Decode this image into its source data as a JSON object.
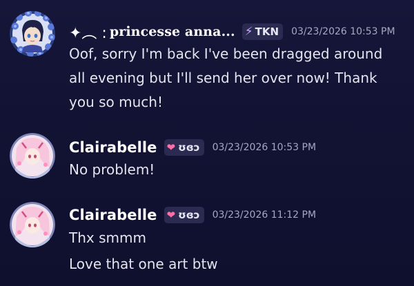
{
  "messages": [
    {
      "author": "princesse anna...",
      "author_prefix": "✦︵ :",
      "tag": {
        "icon": "lightning-icon",
        "text": "TKN"
      },
      "timestamp": "03/23/2026 10:53 PM",
      "lines": [
        "Oof, sorry I'm back I've been dragged around",
        "all evening but I'll send her over now! Thank",
        "you so much!"
      ]
    },
    {
      "author": "Clairabelle",
      "tag": {
        "icon": "heart-icon",
        "text": "ʊɞↄ"
      },
      "timestamp": "03/23/2026 10:53 PM",
      "lines": [
        "No problem!"
      ]
    },
    {
      "author": "Clairabelle",
      "tag": {
        "icon": "heart-icon",
        "text": "ʊɞↄ"
      },
      "timestamp": "03/23/2026 11:12 PM",
      "lines": [
        "Thx smmm",
        "Love that one art btw"
      ]
    }
  ],
  "colors": {
    "background": "#14143a",
    "username": "#ffffff",
    "timestamp": "#a7a7c2",
    "tag_background": "#2b2b52",
    "heart": "#ff6fa8",
    "lightning": "#c8a8ff"
  }
}
